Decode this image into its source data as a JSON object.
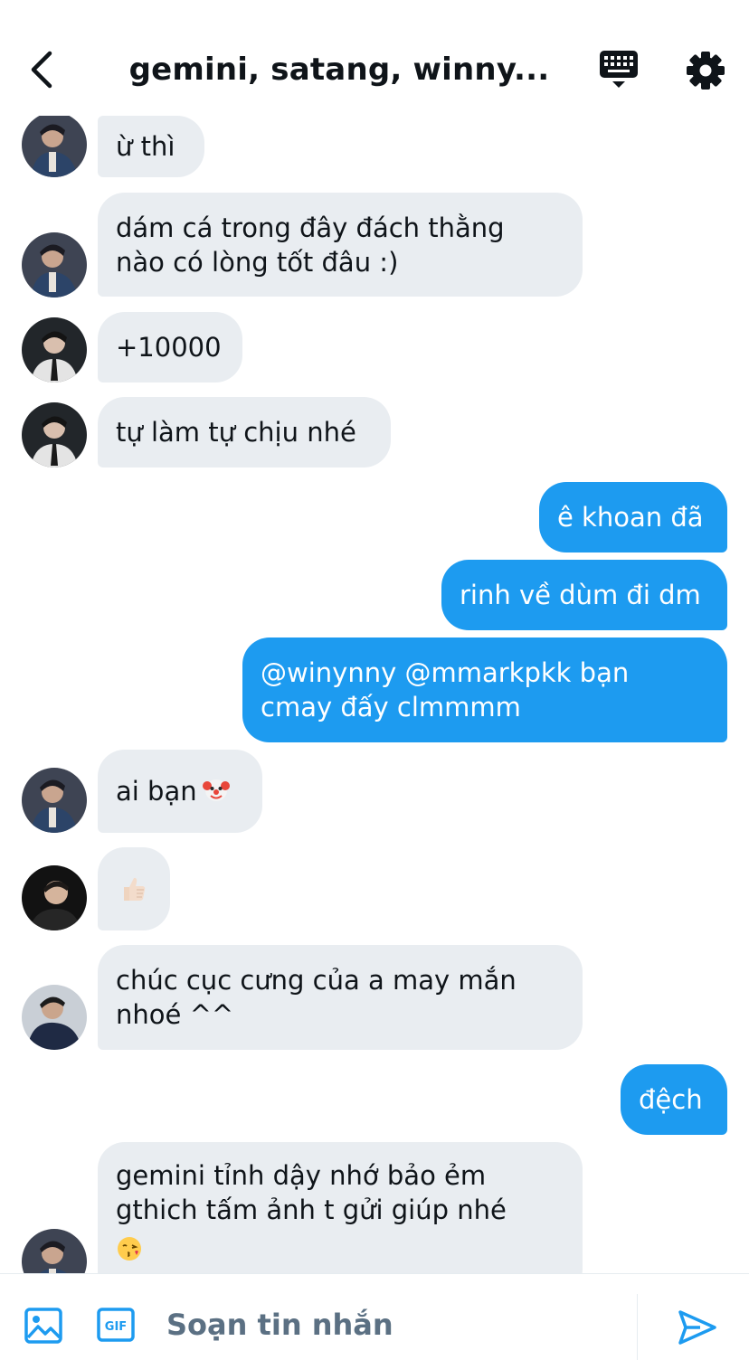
{
  "header": {
    "title": "gemini, satang, winny..."
  },
  "messages": [
    {
      "direction": "in",
      "lines": [
        "ừ thì"
      ]
    },
    {
      "direction": "in",
      "lines": [
        "dám cá trong đây đách thằng",
        "nào có lòng tốt đâu :)"
      ]
    },
    {
      "direction": "in",
      "lines": [
        "+10000"
      ]
    },
    {
      "direction": "in",
      "lines": [
        "tự làm tự chịu nhé"
      ]
    },
    {
      "direction": "out",
      "lines": [
        "ê khoan đã"
      ]
    },
    {
      "direction": "out",
      "lines": [
        "rinh về dùm đi dm"
      ]
    },
    {
      "direction": "out",
      "lines": [
        "@winynny @mmarkpkk bạn",
        "cmay đấy clmmmm"
      ]
    },
    {
      "direction": "in",
      "lines": [
        "ai bạn"
      ],
      "emoji": "clown-face"
    },
    {
      "direction": "in",
      "lines": [],
      "emoji": "thumbs-up"
    },
    {
      "direction": "in",
      "lines": [
        "chúc cục cưng của a may mắn",
        "nhoé ^^"
      ]
    },
    {
      "direction": "out",
      "lines": [
        "đệch"
      ]
    },
    {
      "direction": "in",
      "lines": [
        "gemini tỉnh dậy nhớ bảo ẻm",
        "gthich tấm ảnh t gửi giúp nhé"
      ],
      "emoji": "face-blowing-kiss"
    }
  ],
  "composer": {
    "placeholder": "Soạn tin nhắn"
  },
  "icons": {
    "back": "chevron-left-icon",
    "keyboard": "keyboard-icon",
    "settings": "gear-icon",
    "image": "image-icon",
    "gif": "gif-icon",
    "send": "send-icon"
  },
  "colors": {
    "accent": "#1d9bf0",
    "incoming_bubble": "#e9edf1",
    "text": "#0f1419",
    "muted": "#5b7083"
  }
}
